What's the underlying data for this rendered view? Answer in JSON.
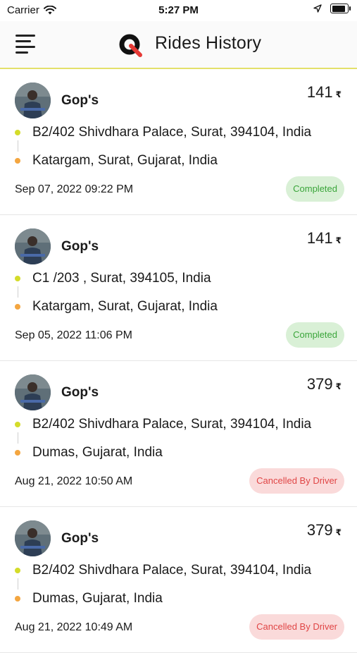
{
  "status_bar": {
    "carrier": "Carrier",
    "time": "5:27 PM",
    "battery_level": 1.0
  },
  "header": {
    "title": "Rides History",
    "menu_icon": "hamburger-menu-icon",
    "logo_icon": "q-logo-icon"
  },
  "colors": {
    "accent": "#e3e06a",
    "pickup_dot": "#d4dc2a",
    "drop_dot": "#f4a640",
    "completed_bg": "#d9f0d6",
    "completed_text": "#3aa53a",
    "cancelled_bg": "#fadada",
    "cancelled_text": "#e04545"
  },
  "rides": [
    {
      "driver_name": "Gop's",
      "fare": "141",
      "currency": "₹",
      "pickup": "B2/402 Shivdhara Palace, Surat, 394104, India",
      "drop": "Katargam, Surat, Gujarat, India",
      "date": "Sep 07, 2022 09:22 PM",
      "status": "Completed",
      "status_type": "completed"
    },
    {
      "driver_name": "Gop's",
      "fare": "141",
      "currency": "₹",
      "pickup": "C1 /203 , Surat, 394105, India",
      "drop": "Katargam, Surat, Gujarat, India",
      "date": "Sep 05, 2022 11:06 PM",
      "status": "Completed",
      "status_type": "completed"
    },
    {
      "driver_name": "Gop's",
      "fare": "379",
      "currency": "₹",
      "pickup": "B2/402 Shivdhara Palace, Surat, 394104, India",
      "drop": "Dumas, Gujarat, India",
      "date": "Aug 21, 2022 10:50 AM",
      "status": "Cancelled By Driver",
      "status_type": "cancelled"
    },
    {
      "driver_name": "Gop's",
      "fare": "379",
      "currency": "₹",
      "pickup": "B2/402 Shivdhara Palace, Surat, 394104, India",
      "drop": "Dumas, Gujarat, India",
      "date": "Aug 21, 2022 10:49 AM",
      "status": "Cancelled By Driver",
      "status_type": "cancelled"
    }
  ]
}
